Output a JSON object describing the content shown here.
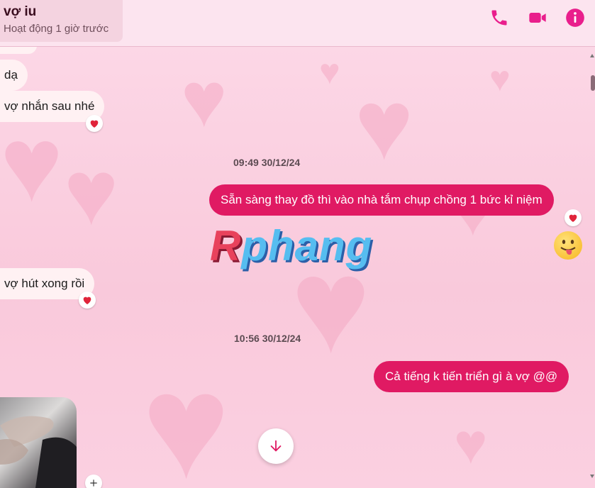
{
  "header": {
    "contact_name": "vợ iu",
    "contact_status": "Hoạt động 1 giờ trước"
  },
  "messages": {
    "recv_1": "dạ",
    "recv_2": "vợ nhắn sau nhé",
    "timestamp_1": "09:49 30/12/24",
    "sent_1": "Sẵn sàng thay đồ thì vào nhà tắm chụp chồng 1 bức kỉ niệm",
    "recv_3": "vợ hút xong rồi",
    "timestamp_2": "10:56 30/12/24",
    "sent_2": "Cả tiếng k tiến triển gì à vợ @@"
  },
  "watermark": {
    "first": "R",
    "rest": "phang"
  },
  "colors": {
    "accent": "#e01a63",
    "header_icon": "#e91e8c",
    "bubble_received": "#fff1f3",
    "background": "#fbd6e6"
  },
  "icons": {
    "phone": "phone-icon",
    "video": "video-call-icon",
    "info": "info-icon",
    "reaction": "heart-reaction-icon",
    "emoji": "tongue-out-emoji",
    "scroll": "arrow-down-icon"
  }
}
